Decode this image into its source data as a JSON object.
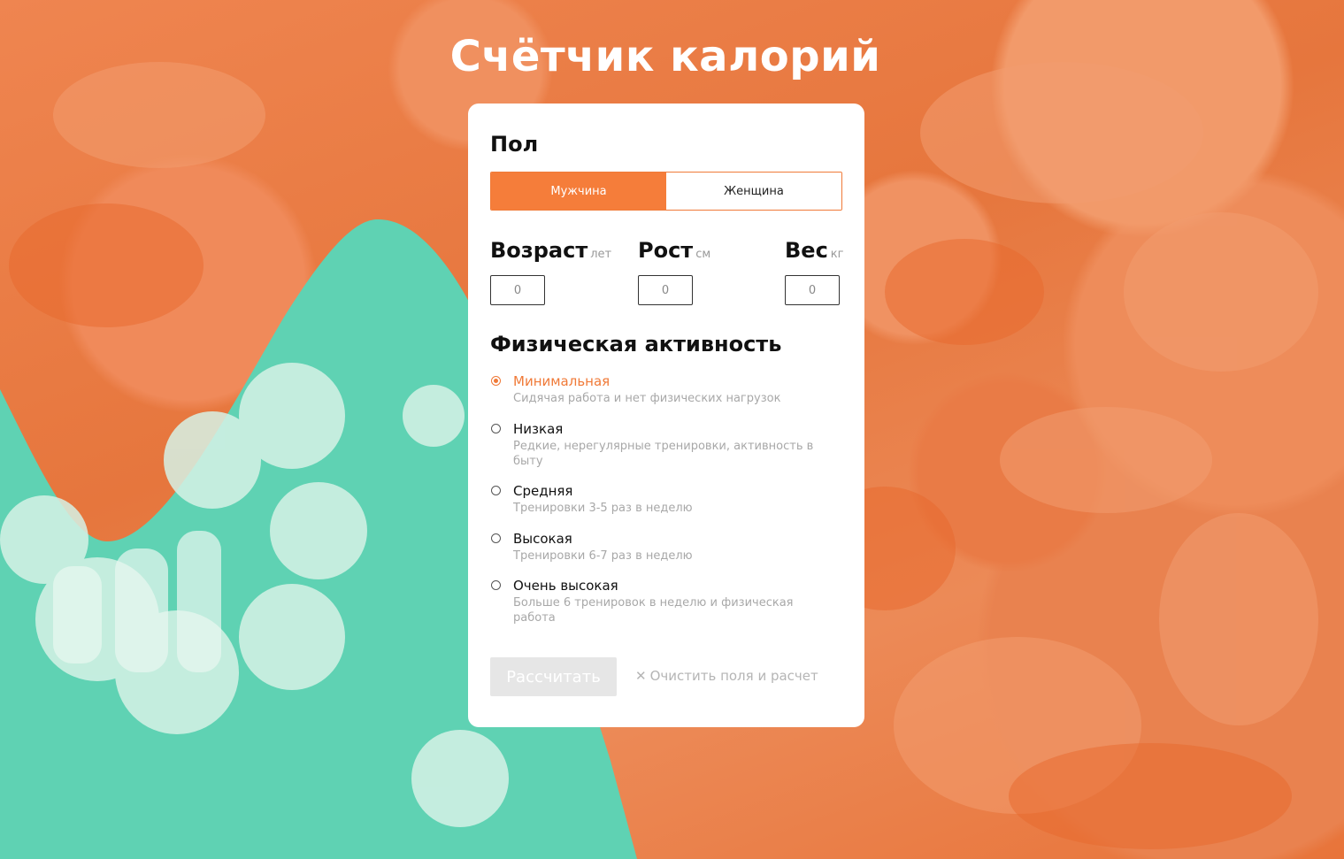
{
  "page": {
    "title": "Счётчик калорий"
  },
  "gender": {
    "section_title": "Пол",
    "options": [
      {
        "label": "Мужчина",
        "selected": true
      },
      {
        "label": "Женщина",
        "selected": false
      }
    ]
  },
  "params": {
    "age": {
      "label": "Возраст",
      "unit": "лет",
      "value": "0"
    },
    "height": {
      "label": "Рост",
      "unit": "см",
      "value": "0"
    },
    "weight": {
      "label": "Вес",
      "unit": "кг",
      "value": "0"
    }
  },
  "activity": {
    "section_title": "Физическая активность",
    "options": [
      {
        "title": "Минимальная",
        "description": "Сидячая работа и нет физических нагрузок",
        "selected": true
      },
      {
        "title": "Низкая",
        "description": "Редкие, нерегулярные тренировки, активность в быту",
        "selected": false
      },
      {
        "title": "Средняя",
        "description": "Тренировки 3-5 раз в неделю",
        "selected": false
      },
      {
        "title": "Высокая",
        "description": "Тренировки 6-7 раз в неделю",
        "selected": false
      },
      {
        "title": "Очень высокая",
        "description": "Больше 6 тренировок в неделю и физическая работа",
        "selected": false
      }
    ]
  },
  "actions": {
    "calculate_label": "Рассчитать",
    "clear_label": "Очистить поля и расчет",
    "clear_icon": "close-icon"
  },
  "colors": {
    "accent": "#f57d3a",
    "background_orange": "#e8763c",
    "background_mint": "#5fd2b3",
    "disabled_button": "#e6e6e6"
  }
}
